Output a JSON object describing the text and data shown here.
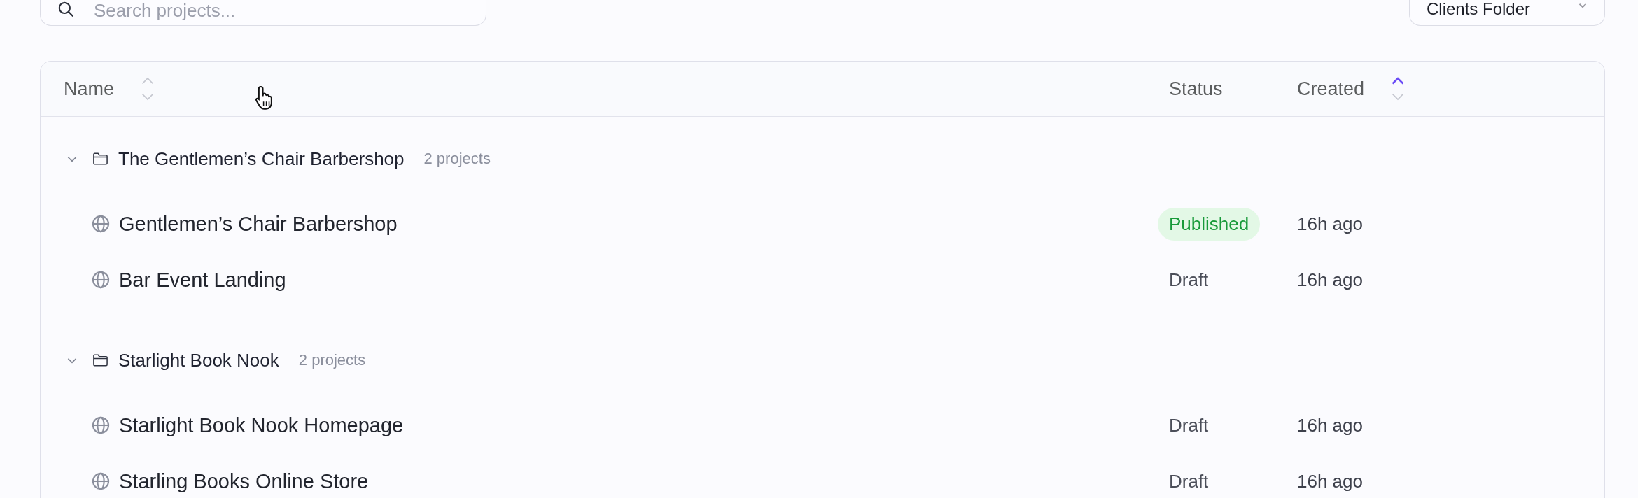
{
  "search": {
    "placeholder": "Search projects..."
  },
  "folder_select": {
    "value": "Clients Folder"
  },
  "table": {
    "columns": [
      {
        "label": "Name",
        "sortable": true,
        "sorted_ascending": false
      },
      {
        "label": "Status",
        "sortable": false
      },
      {
        "label": "Created",
        "sortable": true,
        "sorted_ascending": true
      }
    ],
    "groups": [
      {
        "name": "The Gentlemen’s Chair Barbershop",
        "count": "2 projects",
        "expanded": true,
        "rows": [
          {
            "name": "Gentlemen’s Chair Barbershop",
            "status": "Published",
            "published": true,
            "created": "16h ago"
          },
          {
            "name": "Bar Event Landing",
            "status": "Draft",
            "published": false,
            "created": "16h ago"
          }
        ]
      },
      {
        "name": "Starlight Book Nook",
        "count": "2 projects",
        "expanded": true,
        "rows": [
          {
            "name": "Starlight Book Nook Homepage",
            "status": "Draft",
            "published": false,
            "created": "16h ago"
          },
          {
            "name": "Starling Books Online Store",
            "status": "Draft",
            "published": false,
            "created": "16h ago"
          }
        ]
      }
    ]
  }
}
